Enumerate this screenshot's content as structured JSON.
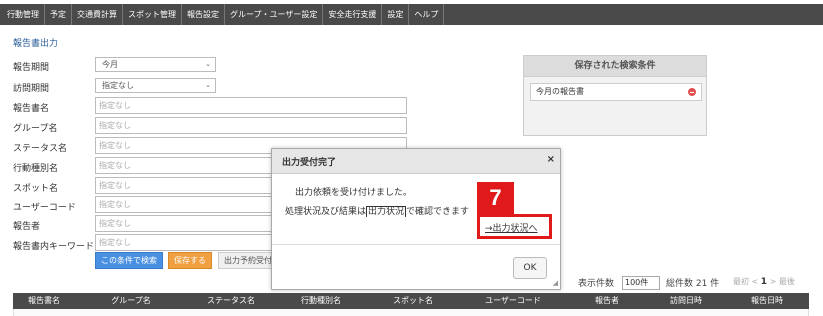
{
  "nav": {
    "items": [
      "行動管理",
      "予定",
      "交通費計算",
      "スポット管理",
      "報告設定",
      "グループ・ユーザー設定",
      "安全走行支援",
      "設定",
      "ヘルプ"
    ]
  },
  "page": {
    "title": "報告書出力"
  },
  "form": {
    "period_label": "報告期間",
    "period_value": "今月",
    "visit_label": "訪問期間",
    "visit_value": "指定なし",
    "report_name_label": "報告書名",
    "group_label": "グループ名",
    "status_label": "ステータス名",
    "activity_label": "行動種別名",
    "spot_label": "スポット名",
    "usercode_label": "ユーザーコード",
    "reporter_label": "報告者",
    "keyword_label": "報告書内キーワード",
    "placeholder": "指定なし",
    "search_button": "この条件で検索",
    "save_button": "保存する",
    "reserve_button": "出力予約受付"
  },
  "saved": {
    "title": "保存された検索条件",
    "items": [
      "今月の報告書"
    ]
  },
  "results": {
    "count_label": "表示件数",
    "per_page": "100件",
    "total": "総件数 21 件",
    "pager_first": "最初",
    "pager_prev": "<",
    "pager_current": "1",
    "pager_next": ">",
    "pager_last": "最後"
  },
  "table": {
    "headers": [
      "報告書名",
      "グループ名",
      "ステータス名",
      "行動種別名",
      "スポット名",
      "ユーザーコード",
      "報告者",
      "訪問日時",
      "報告日時"
    ]
  },
  "modal": {
    "title": "出力受付完了",
    "close": "×",
    "message1": "出力依頼を受け付けました。",
    "message2_pre": "処理状況及び結果は",
    "message2_link": "出力状況",
    "message2_post": "で確認できます",
    "link": "→出力状況へ",
    "ok": "OK"
  },
  "annotation": {
    "step": "7"
  },
  "colors": {
    "accent": "#e01a1a",
    "nav_bg": "#4a4a4a"
  }
}
